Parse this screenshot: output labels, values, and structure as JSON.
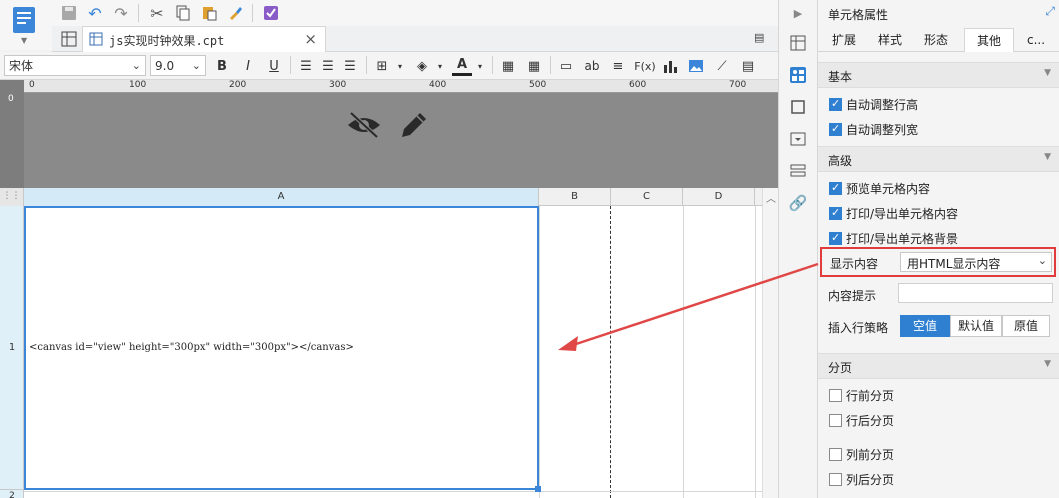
{
  "document_tab": {
    "label": "js实现时钟效果.cpt",
    "close_glyph": "×"
  },
  "format_bar": {
    "font_name": "宋体",
    "font_size": "9.0",
    "bold": "B",
    "italic": "I",
    "underline": "U",
    "text_color_glyph": "A",
    "text_style_glyph": "ab",
    "formula_glyph": "F(x)"
  },
  "ruler": {
    "ticks": [
      "0",
      "100",
      "200",
      "300",
      "400",
      "500",
      "600",
      "700"
    ],
    "v_mark": "0"
  },
  "grid": {
    "corner": "⋮⋮",
    "columns": [
      "A",
      "B",
      "C",
      "D"
    ],
    "rows": [
      "1",
      "2"
    ],
    "cell_a1_text": "<canvas id=\"view\" height=\"300px\" width=\"300px\"></canvas>"
  },
  "panel": {
    "title": "单元格属性",
    "tabs": [
      "扩展",
      "样式",
      "形态",
      "其他",
      "c..."
    ],
    "active_tab": "其他",
    "sections": {
      "basic": "基本",
      "advanced": "高级",
      "paging": "分页"
    },
    "basic_options": [
      {
        "label": "自动调整行高",
        "checked": true
      },
      {
        "label": "自动调整列宽",
        "checked": true
      }
    ],
    "advanced_options": [
      {
        "label": "预览单元格内容",
        "checked": true
      },
      {
        "label": "打印/导出单元格内容",
        "checked": true
      },
      {
        "label": "打印/导出单元格背景",
        "checked": true
      }
    ],
    "display_content": {
      "label": "显示内容",
      "value": "用HTML显示内容"
    },
    "content_hint": {
      "label": "内容提示",
      "value": ""
    },
    "insert_strategy": {
      "label": "插入行策略",
      "options": [
        "空值",
        "默认值",
        "原值"
      ],
      "selected": "空值"
    },
    "paging_options": [
      {
        "label": "行前分页",
        "checked": false
      },
      {
        "label": "行后分页",
        "checked": false
      },
      {
        "label": "列前分页",
        "checked": false
      },
      {
        "label": "列后分页",
        "checked": false
      }
    ]
  },
  "colors": {
    "accent": "#2f80d1",
    "highlight_border": "#e23b3b",
    "selection": "#3b86d9",
    "arrow": "#e04848"
  }
}
